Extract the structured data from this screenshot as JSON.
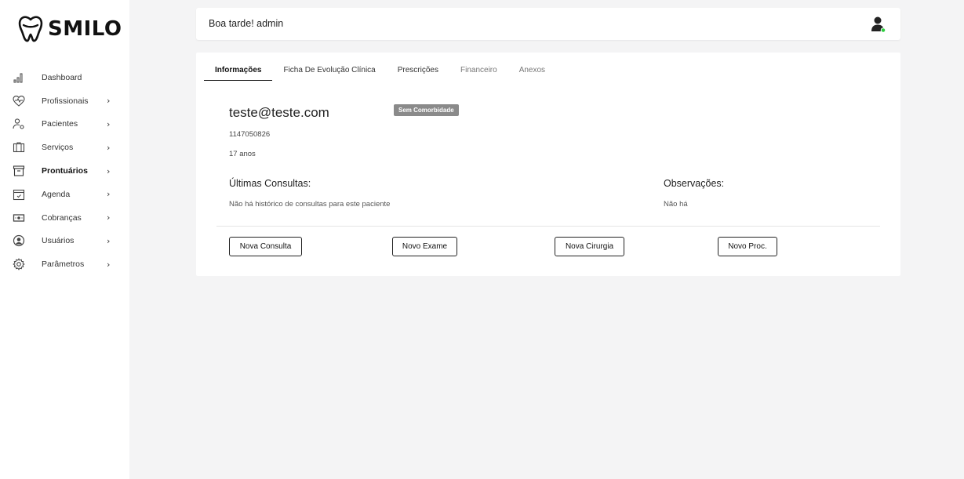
{
  "brand": {
    "name": "SMILO"
  },
  "sidebar": {
    "items": [
      {
        "label": "Dashboard",
        "icon": "bar-chart-icon",
        "has_submenu": false,
        "active": false
      },
      {
        "label": "Profissionais",
        "icon": "heartbeat-icon",
        "has_submenu": true,
        "active": false
      },
      {
        "label": "Pacientes",
        "icon": "user-settings-icon",
        "has_submenu": true,
        "active": false
      },
      {
        "label": "Serviços",
        "icon": "briefcase-icon",
        "has_submenu": true,
        "active": false
      },
      {
        "label": "Prontuários",
        "icon": "archive-icon",
        "has_submenu": true,
        "active": true
      },
      {
        "label": "Agenda",
        "icon": "calendar-check-icon",
        "has_submenu": true,
        "active": false
      },
      {
        "label": "Cobranças",
        "icon": "money-icon",
        "has_submenu": true,
        "active": false
      },
      {
        "label": "Usuários",
        "icon": "user-circle-icon",
        "has_submenu": true,
        "active": false
      },
      {
        "label": "Parâmetros",
        "icon": "gear-icon",
        "has_submenu": true,
        "active": false
      }
    ],
    "chevron": "›"
  },
  "header": {
    "greeting": "Boa tarde! admin",
    "status_color": "#2ecc40"
  },
  "tabs": [
    {
      "label": "Informações",
      "active": true
    },
    {
      "label": "Ficha De Evolução Clínica",
      "active": false
    },
    {
      "label": "Prescrições",
      "active": false
    },
    {
      "label": "Financeiro",
      "active": false
    },
    {
      "label": "Anexos",
      "active": false
    }
  ],
  "patient": {
    "name": "teste@teste.com",
    "badge": "Sem Comorbidade",
    "phone": "1147050826",
    "age": "17 anos"
  },
  "sections": {
    "consultas_title": "Últimas Consultas:",
    "consultas_text": "Não há histórico de consultas para este paciente",
    "observacoes_title": "Observações:",
    "observacoes_text": "Não há"
  },
  "actions": {
    "nova_consulta": "Nova Consulta",
    "novo_exame": "Novo Exame",
    "nova_cirurgia": "Nova Cirurgia",
    "novo_proc": "Novo Proc."
  }
}
